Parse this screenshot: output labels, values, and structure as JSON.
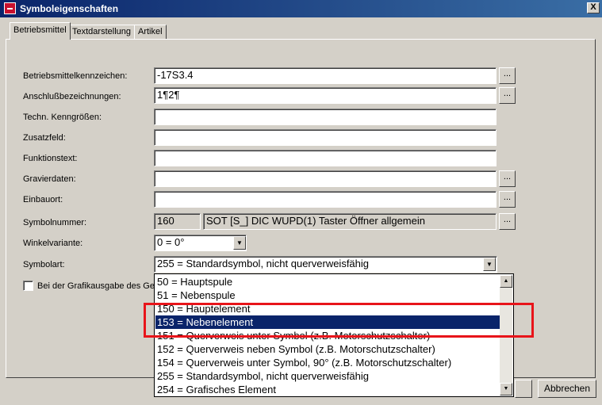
{
  "window": {
    "title": "Symboleigenschaften",
    "close_label": "X"
  },
  "tabs": [
    "Betriebsmittel",
    "Textdarstellung",
    "Artikel"
  ],
  "fields": {
    "betriebsmittel": {
      "label": "Betriebsmittelkennzeichen:",
      "value": "-17S3.4"
    },
    "anschluss": {
      "label": "Anschlußbezeichnungen:",
      "value": "1¶2¶"
    },
    "kenngroessen": {
      "label": "Techn. Kenngrößen:",
      "value": ""
    },
    "zusatzfeld": {
      "label": "Zusatzfeld:",
      "value": ""
    },
    "funktionstext": {
      "label": "Funktionstext:",
      "value": ""
    },
    "gravierdaten": {
      "label": "Gravierdaten:",
      "value": ""
    },
    "einbauort": {
      "label": "Einbauort:",
      "value": ""
    },
    "symbolnummer": {
      "label": "Symbolnummer:",
      "number": "160",
      "description": "SOT [S_] DIC  WUPD(1) Taster Öffner allgemein"
    },
    "winkel": {
      "label": "Winkelvariante:",
      "value": "0 = 0°"
    },
    "symbolart": {
      "label": "Symbolart:",
      "value": "255 = Standardsymbol, nicht querverweisfähig"
    }
  },
  "dots_label": "...",
  "checkbox": {
    "label": "Bei der Grafikausgabe des Gera"
  },
  "dropdown_options": [
    "50 = Hauptspule",
    "51 = Nebenspule",
    "150 = Hauptelement",
    "153 = Nebenelement",
    "151 = Querverweis unter Symbol (z.B. Motorschutzschalter)",
    "152 = Querverweis neben Symbol (z.B. Motorschutzschalter)",
    "154 = Querverweis unter Symbol, 90° (z.B. Motorschutzschalter)",
    "255 = Standardsymbol, nicht querverweisfähig",
    "254 = Grafisches Element"
  ],
  "selected_option": "153 = Nebenelement",
  "buttons": {
    "cancel": "Abbrechen"
  },
  "colors": {
    "selection": "#0a246a",
    "annotation_box": "#e8141a"
  }
}
